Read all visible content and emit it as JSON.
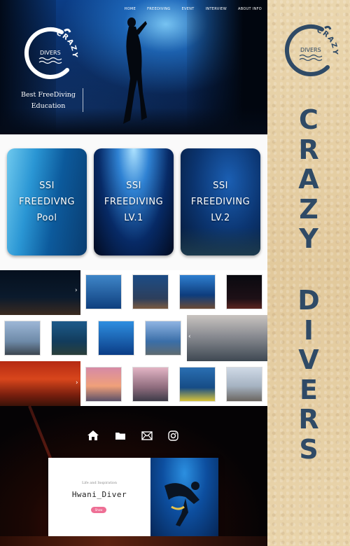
{
  "brand": {
    "logo_word": "CRAZY",
    "logo_sub": "DIVERS"
  },
  "nav": {
    "items": [
      "Home",
      "Freediving",
      "Event",
      "Interview",
      "About Info"
    ]
  },
  "hero": {
    "tagline_line1": "Best FreeDiving",
    "tagline_line2": "Education"
  },
  "cards": [
    {
      "line1": "SSI",
      "line2": "FREEDIVNG",
      "line3": "Pool"
    },
    {
      "line1": "SSI",
      "line2": "FREEDIVING",
      "line3": "LV.1"
    },
    {
      "line1": "SSI",
      "line2": "FREEDIVING",
      "line3": "LV.2"
    }
  ],
  "footer_icons": [
    "home-icon",
    "folder-icon",
    "mail-icon",
    "instagram-icon"
  ],
  "profile": {
    "subtitle": "Life and Inspiration",
    "name": "Hwani_Diver",
    "button": "Show"
  },
  "side_title": {
    "word1": [
      "C",
      "R",
      "A",
      "Z",
      "Y"
    ],
    "word2": [
      "D",
      "I",
      "V",
      "E",
      "R",
      "S"
    ]
  },
  "colors": {
    "navy": "#2f4a66",
    "pink_button": "#ee6f95",
    "sand": "#e8d2a8"
  }
}
